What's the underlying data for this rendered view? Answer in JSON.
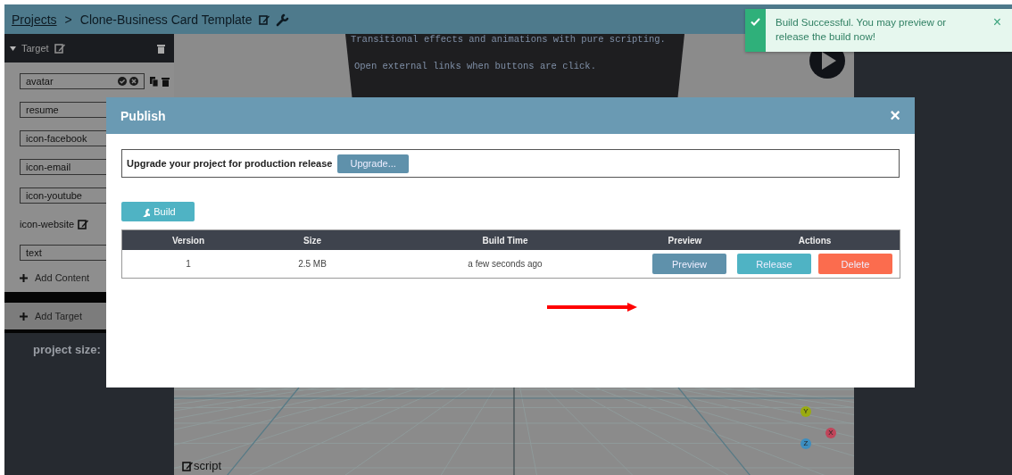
{
  "header": {
    "breadcrumb_link": "Projects",
    "separator": ">",
    "title": "Clone-Business Card Template"
  },
  "sidebar": {
    "target": {
      "label": "Target",
      "expanded": true
    },
    "items": [
      {
        "kind": "editing",
        "label": "avatar"
      },
      {
        "kind": "field",
        "label": "resume"
      },
      {
        "kind": "field",
        "label": "icon-facebook"
      },
      {
        "kind": "field",
        "label": "icon-email"
      },
      {
        "kind": "field",
        "label": "icon-youtube"
      },
      {
        "kind": "plain",
        "label": "icon-website"
      },
      {
        "kind": "field",
        "label": "text"
      }
    ],
    "add_content": "Add Content",
    "add_target": "Add Target",
    "project_size": "project size:"
  },
  "viewport": {
    "code_lines": [
      "Transitional effects and animations with pure scripting.",
      "Open external links when buttons are click."
    ],
    "axes": [
      {
        "label": "Y",
        "color": "#9aab10"
      },
      {
        "label": "X",
        "color": "#c0455a"
      },
      {
        "label": "Z",
        "color": "#3d8ec0"
      }
    ],
    "script_label": "script"
  },
  "toast": {
    "message": "Build Successful. You may preview or release the build now!",
    "close": "×"
  },
  "modal": {
    "title": "Publish",
    "close": "×",
    "upgrade_text": "Upgrade your project for production release",
    "upgrade_button": "Upgrade...",
    "build_button": "Build",
    "table": {
      "columns": [
        "Version",
        "Size",
        "Build Time",
        "Preview",
        "Actions"
      ],
      "rows": [
        {
          "version": "1",
          "size": "2.5 MB",
          "build_time": "a few seconds ago",
          "buttons": [
            {
              "kind": "preview",
              "label": "Preview"
            },
            {
              "kind": "release",
              "label": "Release"
            },
            {
              "kind": "delete",
              "label": "Delete"
            }
          ]
        }
      ]
    }
  }
}
